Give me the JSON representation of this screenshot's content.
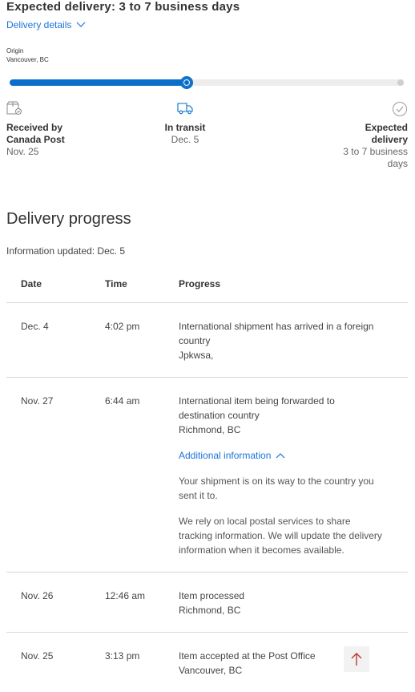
{
  "header": {
    "title": "Expected delivery: 3 to 7 business days",
    "details_link": "Delivery details"
  },
  "origin": {
    "label": "Origin",
    "city": "Vancouver, BC"
  },
  "tracker": {
    "progress_fraction": 0.45,
    "accent_color": "#0a6ecb"
  },
  "steps": [
    {
      "name_line1": "Received by",
      "name_line2": "Canada Post",
      "sub_line1": "Nov. 25",
      "sub_line2": "",
      "icon": "package-icon"
    },
    {
      "name_line1": "In transit",
      "name_line2": "",
      "sub_line1": "Dec. 5",
      "sub_line2": "",
      "icon": "truck-icon"
    },
    {
      "name_line1": "Expected",
      "name_line2": "delivery",
      "sub_line1": "3 to 7 business",
      "sub_line2": "days",
      "icon": "check-circle-icon"
    }
  ],
  "progress": {
    "title": "Delivery progress",
    "updated": "Information updated: Dec. 5",
    "columns": [
      "Date",
      "Time",
      "Progress"
    ],
    "rows": [
      {
        "date": "Dec. 4",
        "time": "4:02 pm",
        "line1": "International shipment has arrived in a foreign",
        "line2": "country",
        "location": "Jpkwsa,"
      },
      {
        "date": "Nov. 27",
        "time": "6:44 am",
        "line1": "International item being forwarded to",
        "line2": "destination country",
        "location": "Richmond, BC",
        "additional_label": "Additional information",
        "para1_l1": "Your shipment is on its way to the country you",
        "para1_l2": "sent it to.",
        "para2_l1": "We rely on local postal services to share",
        "para2_l2": "tracking information. We will update the delivery",
        "para2_l3": "information when it becomes available."
      },
      {
        "date": "Nov. 26",
        "time": "12:46 am",
        "line1": "Item processed",
        "location": "Richmond, BC"
      },
      {
        "date": "Nov. 25",
        "time": "3:13 pm",
        "line1": "Item accepted at the Post Office",
        "location": "Vancouver, BC"
      }
    ]
  },
  "scroll_top_icon": "arrow-up-icon"
}
